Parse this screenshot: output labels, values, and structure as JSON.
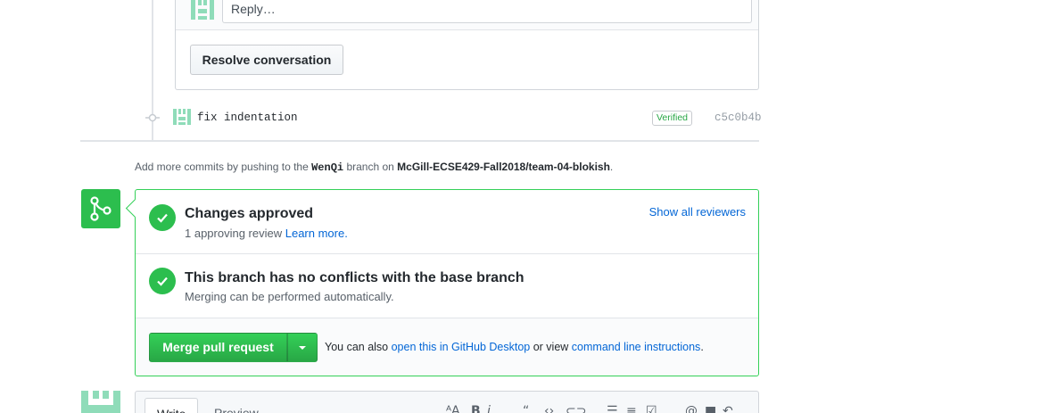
{
  "review": {
    "reply_placeholder": "Reply…",
    "resolve_label": "Resolve conversation"
  },
  "commit": {
    "message": "fix indentation",
    "verified": "Verified",
    "sha": "c5c0b4b"
  },
  "push_note": {
    "prefix": "Add more commits by pushing to the ",
    "branch": "WenQi",
    "middle": " branch on ",
    "repo": "McGill-ECSE429-Fall2018/team-04-blokish",
    "suffix": "."
  },
  "merge": {
    "approved_title": "Changes approved",
    "approved_count": "1 approving review ",
    "learn_more": "Learn more.",
    "show_reviewers": "Show all reviewers",
    "conflicts_title": "This branch has no conflicts with the base branch",
    "conflicts_sub": "Merging can be performed automatically.",
    "merge_button": "Merge pull request",
    "alt_prefix": "You can also ",
    "desktop_link": "open this in GitHub Desktop",
    "alt_middle": " or view ",
    "cli_link": "command line instructions",
    "alt_suffix": "."
  },
  "editor": {
    "tab_write": "Write",
    "tab_preview": "Preview",
    "toolbar_icons": [
      "text-size-icon",
      "bold-icon",
      "italic-icon",
      "quote-icon",
      "code-icon",
      "link-icon",
      "unordered-list-icon",
      "ordered-list-icon",
      "task-list-icon",
      "mention-icon",
      "bookmark-icon",
      "reply-icon"
    ]
  },
  "colors": {
    "green": "#2cbe4e",
    "green_border": "#34d058",
    "link_blue": "#0366d6",
    "identicon": "#8fdcb9"
  }
}
